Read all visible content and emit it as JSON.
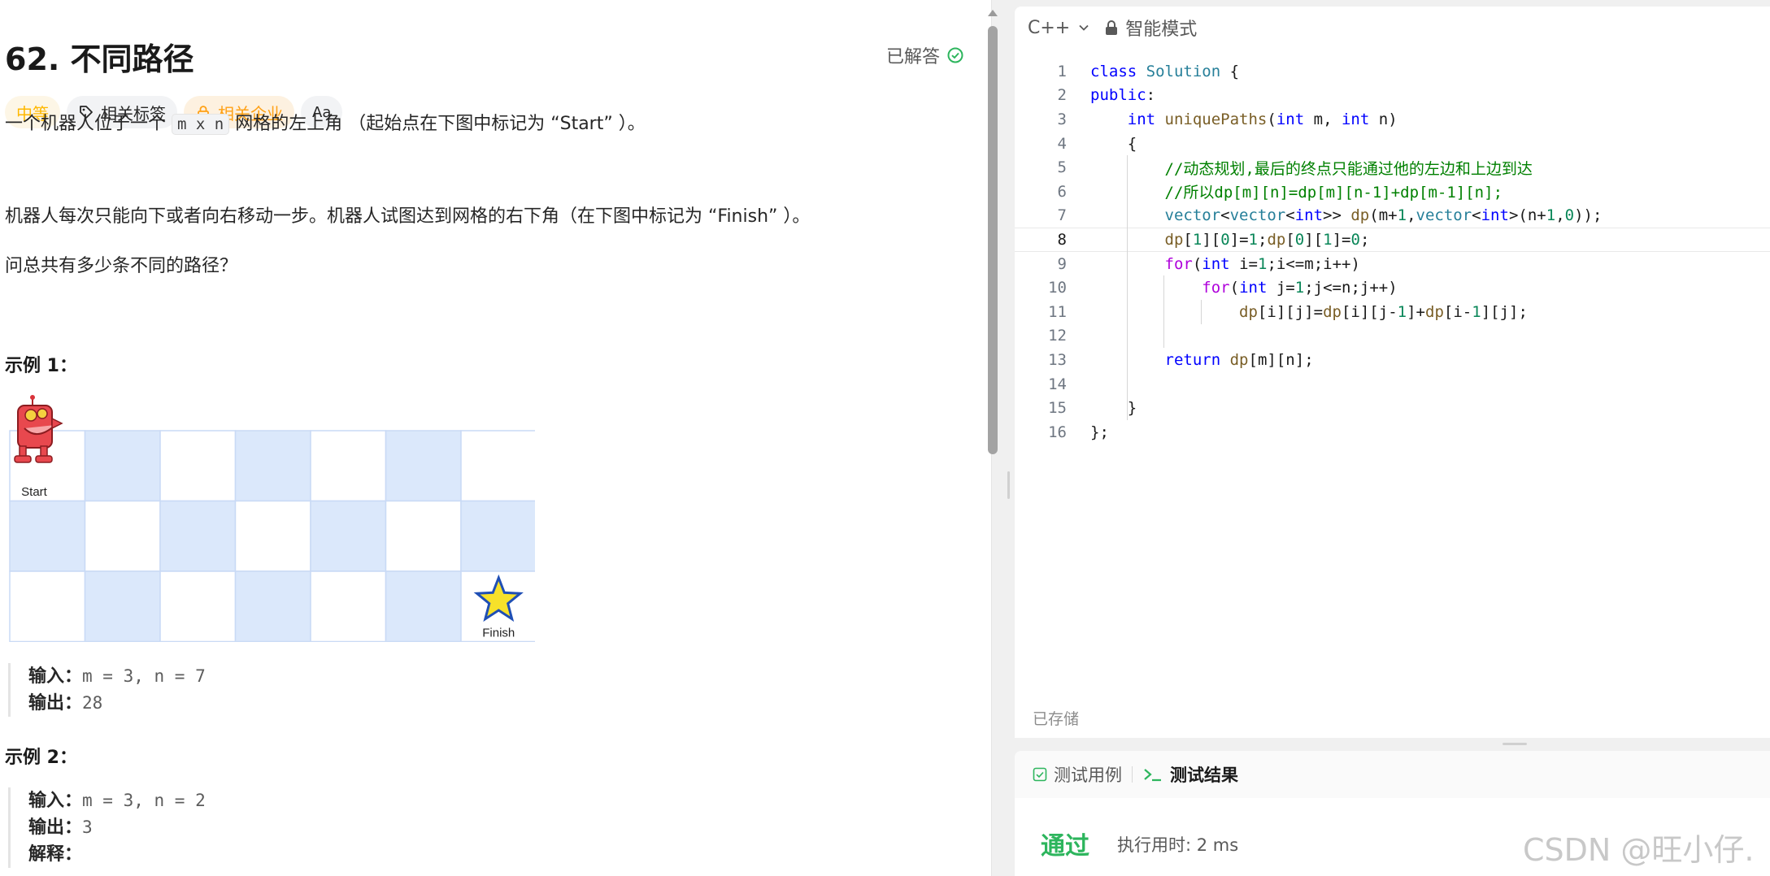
{
  "problem": {
    "title": "62. 不同路径",
    "status": "已解答",
    "tags": {
      "difficulty": "中等",
      "topics": "相关标签",
      "companies": "相关企业",
      "translate": "Aa"
    },
    "desc1_before": "一个机器人位于一个",
    "desc1_code": "m x n",
    "desc1_after": "网格的左上角 （起始点在下图中标记为 “Start” ）。",
    "desc2": "机器人每次只能向下或者向右移动一步。机器人试图达到网格的右下角（在下图中标记为 “Finish” ）。",
    "desc3": "问总共有多少条不同的路径？",
    "example1_title": "示例 1：",
    "grid": {
      "rows": 3,
      "cols": 7,
      "start_label": "Start",
      "finish_label": "Finish",
      "cell_color": "#dbe8fb",
      "border_color": "#c9daf5"
    },
    "example1": {
      "input_label": "输入：",
      "input": "m = 3, n = 7",
      "output_label": "输出：",
      "output": "28"
    },
    "example2_title": "示例 2：",
    "example2": {
      "input_label": "输入：",
      "input": "m = 3, n = 2",
      "output_label": "输出：",
      "output": "3",
      "explain_label": "解释："
    }
  },
  "editor": {
    "language": "C++",
    "mode": "智能模式",
    "saved": "已存储",
    "current_line": 8,
    "lines": [
      "class Solution {",
      "public:",
      "    int uniquePaths(int m, int n)",
      "    {",
      "        //动态规划,最后的终点只能通过他的左边和上边到达",
      "        //所以dp[m][n]=dp[m][n-1]+dp[m-1][n];",
      "        vector<vector<int>> dp(m+1,vector<int>(n+1,0));",
      "        dp[1][0]=1;dp[0][1]=0;",
      "        for(int i=1;i<=m;i++)",
      "            for(int j=1;j<=n;j++)",
      "                dp[i][j]=dp[i][j-1]+dp[i-1][j];",
      "",
      "        return dp[m][n];",
      "",
      "    }",
      "};"
    ]
  },
  "result": {
    "tab_testcase": "测试用例",
    "tab_result": "测试结果",
    "verdict": "通过",
    "runtime": "执行用时: 2 ms"
  },
  "watermark": "CSDN @旺小仔."
}
